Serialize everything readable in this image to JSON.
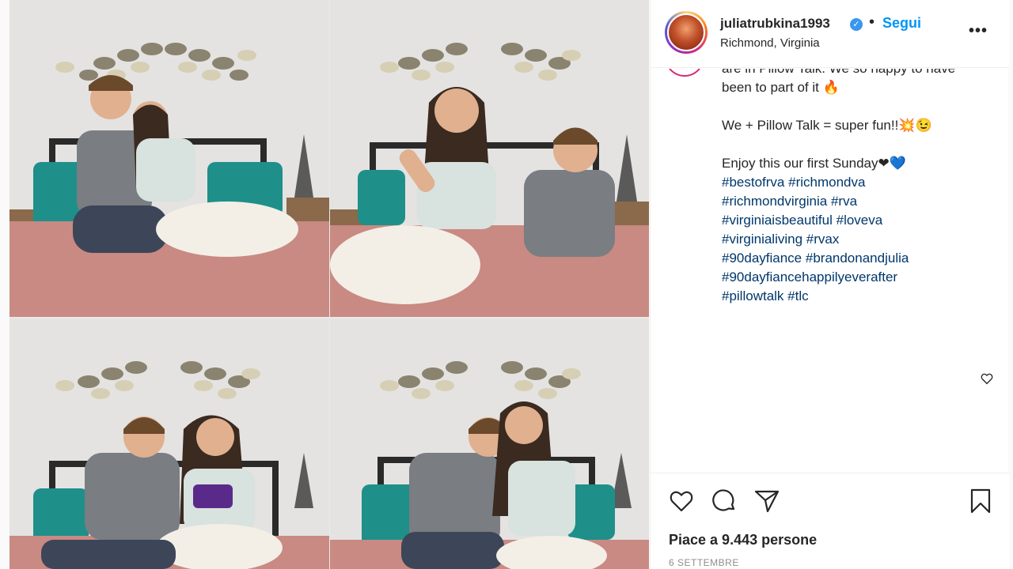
{
  "post": {
    "username": "juliatrubkina1993",
    "verified_icon": "verified-badge-icon",
    "separator": "•",
    "follow_label": "Segui",
    "location": "Richmond, Virginia",
    "more_label": "•••"
  },
  "caption": {
    "cut_line": "are in Pillow Talk. We so happy to have",
    "line1": "been to part of it 🔥",
    "line2": "We + Pillow Talk = super fun!!💥😉",
    "line3": "Enjoy this our first Sunday❤💙",
    "hashtag_lines": [
      [
        "#bestofrva",
        "#richmondva"
      ],
      [
        "#richmondvirginia",
        "#rva"
      ],
      [
        "#virginiaisbeautiful",
        "#loveva"
      ],
      [
        "#virginialiving",
        "#rvax"
      ],
      [
        "#90dayfiance",
        "#brandonandjulia"
      ],
      [
        "#90dayfiancehappilyeverafter"
      ],
      [
        "#pillowtalk",
        "#tlc"
      ]
    ]
  },
  "actions": {
    "like_icon": "heart-icon",
    "comment_icon": "comment-icon",
    "share_icon": "paper-plane-icon",
    "save_icon": "bookmark-icon"
  },
  "likes_text": "Piace a 9.443 persone",
  "date_text": "6 SETTEMBRE",
  "colors": {
    "accent_blue": "#0095f6",
    "hashtag": "#00376b",
    "text": "#262626",
    "muted": "#8e8e8e",
    "bedspread": "#c88a82",
    "pillow_teal": "#1f8f8a"
  }
}
